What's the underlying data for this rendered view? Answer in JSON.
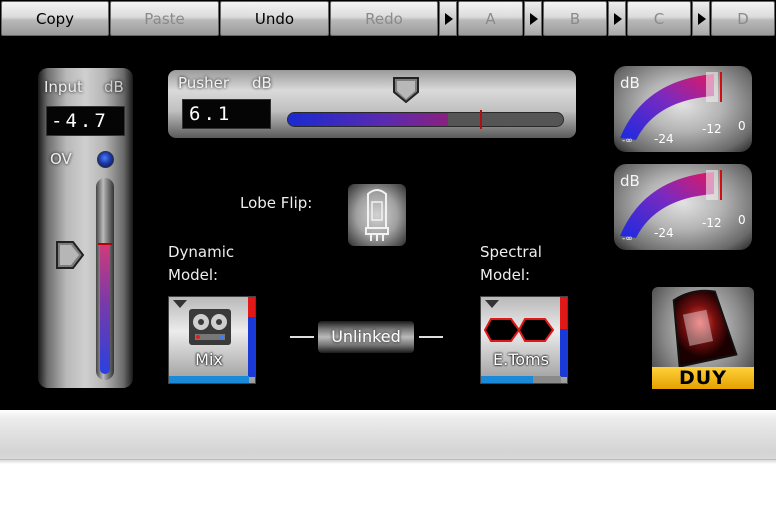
{
  "toolbar": {
    "copy": "Copy",
    "paste": "Paste",
    "undo": "Undo",
    "redo": "Redo",
    "preset_a": "A",
    "preset_b": "B",
    "preset_c": "C",
    "preset_d": "D"
  },
  "input": {
    "label": "Input",
    "unit": "dB",
    "value": "-4.7",
    "ov_label": "OV"
  },
  "pusher": {
    "label": "Pusher",
    "unit": "dB",
    "value": "6.1",
    "meter_fraction": 0.58
  },
  "gauges": [
    {
      "unit": "dB",
      "ticks": [
        "-∞",
        "-24",
        "-12",
        "0"
      ]
    },
    {
      "unit": "dB",
      "ticks": [
        "-∞",
        "-24",
        "-12",
        "0"
      ]
    }
  ],
  "lobe_flip": {
    "label": "Lobe Flip:"
  },
  "dynamic_model": {
    "label_line1": "Dynamic",
    "label_line2": "Model:",
    "name": "Mix"
  },
  "spectral_model": {
    "label_line1": "Spectral",
    "label_line2": "Model:",
    "name": "E.Toms"
  },
  "link": {
    "label": "Unlinked"
  },
  "logo": {
    "text": "DUY"
  },
  "colors": {
    "accent_blue": "#1a3ad8",
    "accent_red": "#e01818",
    "logo_yellow": "#ffc21a"
  }
}
